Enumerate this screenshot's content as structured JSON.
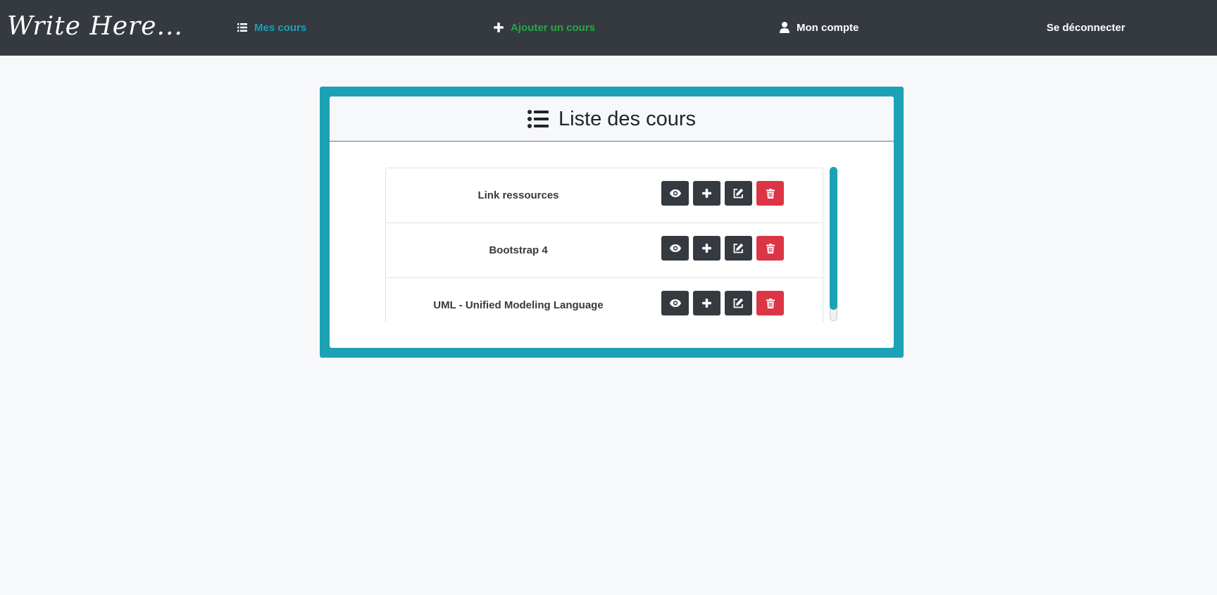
{
  "brand": {
    "name": "Write Here..."
  },
  "nav": {
    "mes_cours": {
      "label": "Mes cours",
      "icon": "list-icon",
      "color": "#17a2b8"
    },
    "ajouter": {
      "label": "Ajouter un cours",
      "icon": "plus-icon",
      "color": "#28a745"
    },
    "compte": {
      "label": "Mon compte",
      "icon": "user-icon"
    },
    "deconnecter": {
      "label": "Se déconnecter"
    }
  },
  "panel": {
    "title": "Liste des cours",
    "title_icon": "list-icon",
    "accent_color": "#1ca2b5"
  },
  "courses": [
    {
      "name": "Link ressources"
    },
    {
      "name": "Bootstrap 4"
    },
    {
      "name": "UML - Unified Modeling Language"
    }
  ],
  "row_actions": [
    {
      "icon": "eye-icon",
      "style": "dark"
    },
    {
      "icon": "plus-icon",
      "style": "dark"
    },
    {
      "icon": "edit-icon",
      "style": "dark"
    },
    {
      "icon": "trash-icon",
      "style": "danger"
    }
  ],
  "colors": {
    "navbar": "#343a40",
    "dark_button": "#343a40",
    "danger_button": "#dc3545"
  }
}
